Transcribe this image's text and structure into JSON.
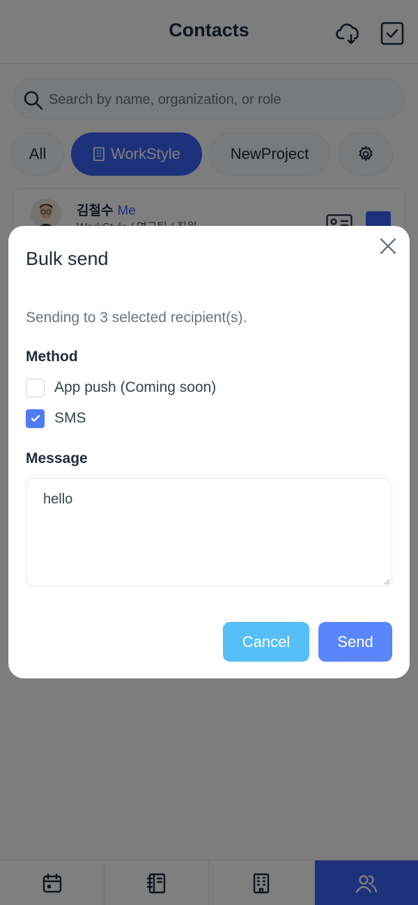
{
  "header": {
    "title": "Contacts"
  },
  "search": {
    "placeholder": "Search by name, organization, or role"
  },
  "tabs": [
    {
      "label": "All"
    },
    {
      "label": "WorkStyle"
    },
    {
      "label": "NewProject"
    }
  ],
  "contact": {
    "name": "김철수",
    "me_badge": "Me",
    "info": "WorkStyle / 연구팀 / 직원",
    "selected": true
  },
  "modal": {
    "title": "Bulk send",
    "info": "Sending to 3 selected recipient(s).",
    "method_label": "Method",
    "options": [
      {
        "label": "App push (Coming soon)",
        "checked": false
      },
      {
        "label": "SMS",
        "checked": true
      }
    ],
    "message_label": "Message",
    "message_value": "hello",
    "cancel_label": "Cancel",
    "send_label": "Send"
  },
  "colors": {
    "accent": "#3b63f6",
    "cancel": "#56bff8",
    "send": "#5a86fb"
  },
  "bottom_nav": [
    {
      "icon": "calendar-icon"
    },
    {
      "icon": "notebook-icon"
    },
    {
      "icon": "building-icon"
    },
    {
      "icon": "users-icon",
      "active": true
    }
  ]
}
